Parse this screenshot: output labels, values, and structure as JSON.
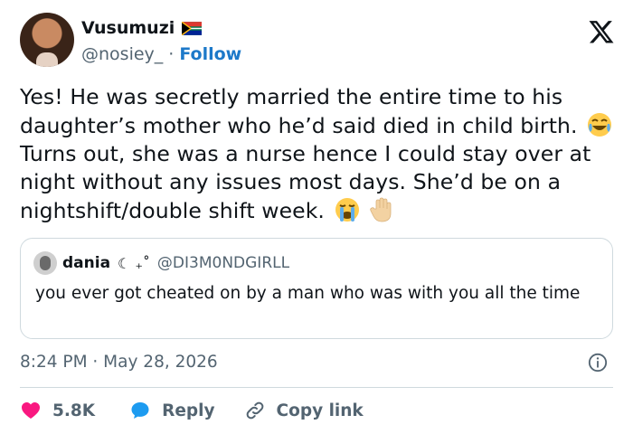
{
  "author": {
    "name": "Vusumuzi",
    "handle": "@nosiey_",
    "separator": "·",
    "follow_label": "Follow"
  },
  "tweet": {
    "line1": "Yes! He was secretly married the entire time to his daughter’s mother who he’d said died in child birth.",
    "line2": "Turns out, she was a nurse hence I could stay over at night without any issues most days. She’d be on a nightshift/double shift week."
  },
  "quote": {
    "name": "dania",
    "decoration": "☾ ₊˚",
    "handle": "@DI3M0NDGIRLL",
    "text": "you ever got cheated on by a man who was with you all the time"
  },
  "meta": {
    "timestamp": "8:24 PM · May 28, 2026"
  },
  "actions": {
    "likes": "5.8K",
    "reply_label": "Reply",
    "copy_label": "Copy link"
  },
  "icons": [
    "south-africa-flag-icon",
    "x-logo-icon",
    "laughing-tears-emoji",
    "crying-emoji",
    "raised-hand-emoji",
    "info-icon",
    "heart-icon",
    "reply-bubble-icon",
    "link-icon"
  ],
  "colors": {
    "text": "#0f1419",
    "secondary": "#536471",
    "follow": "#1d79c9",
    "like": "#f91880",
    "reply": "#1d9bf0",
    "border": "#cfd9de"
  }
}
